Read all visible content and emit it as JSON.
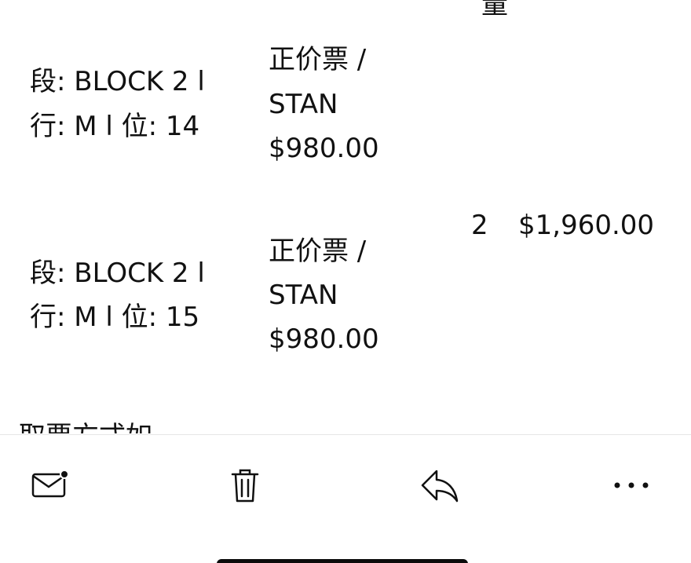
{
  "order": {
    "qty_header": "量",
    "items": [
      {
        "seat_line1": "段: BLOCK 2 l",
        "seat_line2": "行: M l 位: 14",
        "ticket_type_line1": "正价票 /",
        "ticket_type_line2": "STAN",
        "price": "$980.00"
      },
      {
        "seat_line1": "段: BLOCK 2 l",
        "seat_line2": "行: M l 位: 15",
        "ticket_type_line1": "正价票 /",
        "ticket_type_line2": "STAN",
        "price": "$980.00"
      }
    ],
    "quantity": "2",
    "total": "$1,960.00",
    "next_section_partial": "取票方式如"
  },
  "toolbar": {
    "icons": [
      "mail-unread-icon",
      "trash-icon",
      "reply-icon",
      "more-icon"
    ]
  },
  "colors": {
    "background": "#ffffff",
    "text": "#111111",
    "divider": "#e6e6e6",
    "home_indicator": "#0b0b0b"
  }
}
